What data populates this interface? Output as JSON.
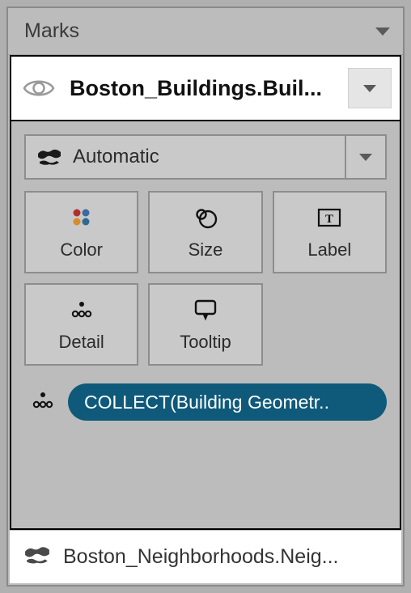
{
  "panel": {
    "title": "Marks"
  },
  "active_layer": {
    "title": "Boston_Buildings.Buil...",
    "icon": "eye-icon"
  },
  "mark_type": {
    "label": "Automatic",
    "icon": "globe-icon"
  },
  "shelves": {
    "color": "Color",
    "size": "Size",
    "label": "Label",
    "detail": "Detail",
    "tooltip": "Tooltip"
  },
  "pill": {
    "icon": "detail-icon",
    "text": "COLLECT(Building Geometr.."
  },
  "collapsed_layer": {
    "title": "Boston_Neighborhoods.Neig...",
    "icon": "globe-icon"
  }
}
